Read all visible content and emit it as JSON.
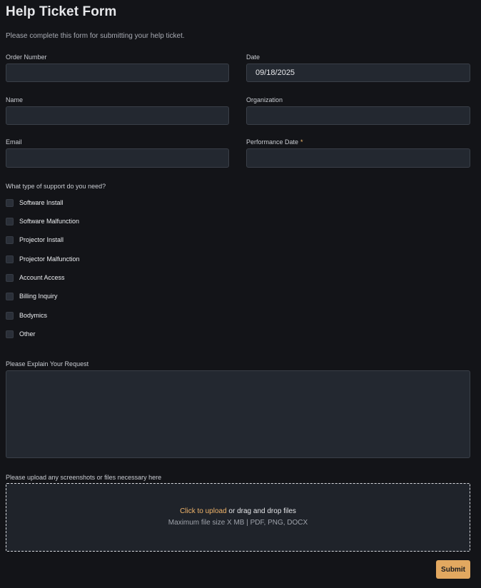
{
  "form": {
    "title": "Help Ticket Form",
    "subtitle": "Please complete this form for submitting your help ticket."
  },
  "fields": {
    "order_number": {
      "label": "Order Number",
      "value": ""
    },
    "date": {
      "label": "Date",
      "value": "09/18/2025"
    },
    "name": {
      "label": "Name",
      "value": ""
    },
    "organization": {
      "label": "Organization",
      "value": ""
    },
    "email": {
      "label": "Email",
      "value": ""
    },
    "performance_date": {
      "label": "Performance Date",
      "required_marker": "*",
      "value": ""
    }
  },
  "support": {
    "question": "What type of support do you need?",
    "options": [
      {
        "label": "Software Install",
        "checked": false
      },
      {
        "label": "Software Malfunction",
        "checked": false
      },
      {
        "label": "Projector Install",
        "checked": false
      },
      {
        "label": "Projector Malfunction",
        "checked": false
      },
      {
        "label": "Account Access",
        "checked": false
      },
      {
        "label": "Billing Inquiry",
        "checked": false
      },
      {
        "label": "Bodymics",
        "checked": false
      },
      {
        "label": "Other",
        "checked": false
      }
    ]
  },
  "request": {
    "label": "Please Explain Your Request",
    "value": ""
  },
  "upload": {
    "label": "Please upload any screenshots or files necessary here",
    "link_text": "Click to upload",
    "rest_text": " or drag and drop files",
    "hint": "Maximum file size X MB | PDF, PNG, DOCX"
  },
  "actions": {
    "submit_label": "Submit"
  },
  "colors": {
    "background": "#131418",
    "field_background": "#232830",
    "accent": "#e2a860"
  }
}
